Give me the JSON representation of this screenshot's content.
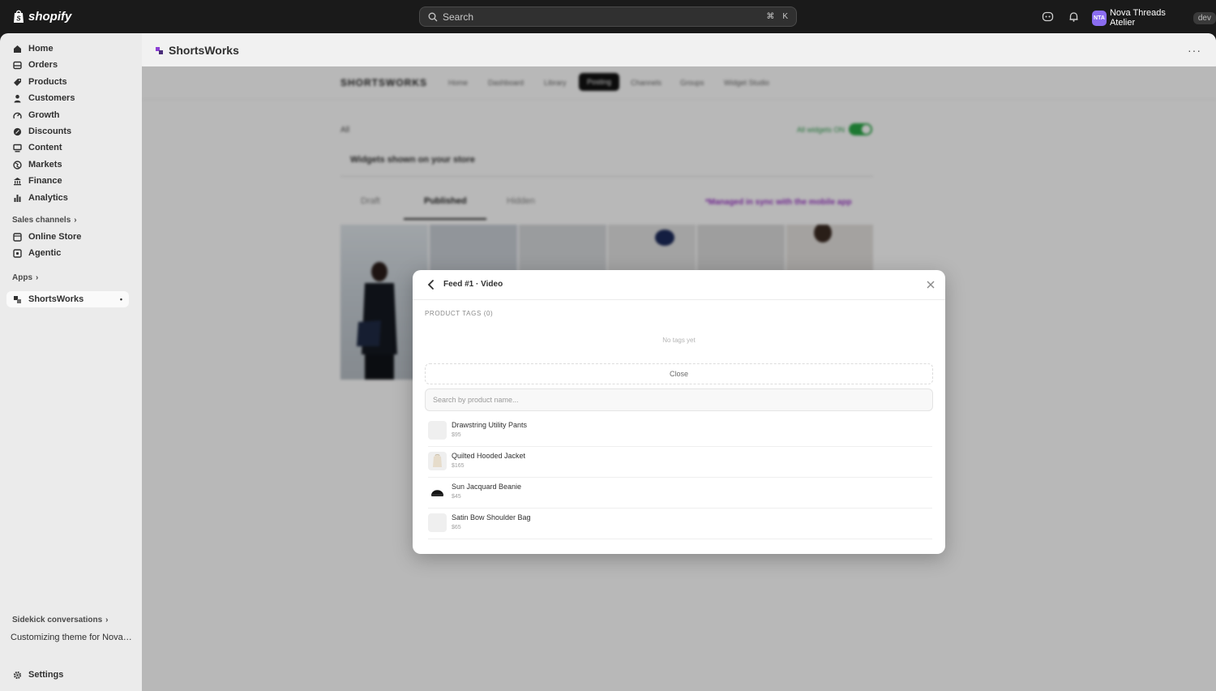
{
  "topbar": {
    "brand": "shopify",
    "search_placeholder": "Search",
    "shortcut_cmd": "⌘",
    "shortcut_key": "K",
    "avatar_initials": "NTA",
    "store_name": "Nova Threads Atelier",
    "env_badge": "dev"
  },
  "sidebar": {
    "items": [
      {
        "label": "Home",
        "icon": "home-icon"
      },
      {
        "label": "Orders",
        "icon": "orders-icon"
      },
      {
        "label": "Products",
        "icon": "tag-icon"
      },
      {
        "label": "Customers",
        "icon": "person-icon"
      },
      {
        "label": "Growth",
        "icon": "growth-icon"
      },
      {
        "label": "Discounts",
        "icon": "discount-icon"
      },
      {
        "label": "Content",
        "icon": "content-icon"
      },
      {
        "label": "Markets",
        "icon": "globe-icon"
      },
      {
        "label": "Finance",
        "icon": "bank-icon"
      },
      {
        "label": "Analytics",
        "icon": "bar-chart-icon"
      }
    ],
    "sales_channels_label": "Sales channels",
    "channels": [
      {
        "label": "Online Store",
        "icon": "store-icon"
      },
      {
        "label": "Agentic",
        "icon": "agentic-icon"
      }
    ],
    "apps_label": "Apps",
    "apps": [
      {
        "label": "ShortsWorks",
        "icon": "shortsworks-icon",
        "active": true
      }
    ],
    "sidekick_label": "Sidekick conversations",
    "sidekick_item": "Customizing theme for Nova Threads Atelier",
    "settings_label": "Settings"
  },
  "app": {
    "title": "ShortsWorks",
    "more_label": "···",
    "brand_logo": "SHORTSWORKS",
    "tabs": [
      "Home",
      "Dashboard",
      "Library",
      "Posting",
      "Channels",
      "Groups",
      "Widget Studio"
    ],
    "active_tab": "Posting",
    "filter_label": "All",
    "switch_label": "All widgets ON",
    "widgets_title": "Widgets shown on your store",
    "subtabs": [
      "Draft",
      "Published",
      "Hidden"
    ],
    "active_subtab": "Published",
    "sync_note": "*Managed in sync with the mobile app"
  },
  "modal": {
    "title": "Feed #1 · Video",
    "tags_label": "PRODUCT TAGS (0)",
    "empty_text": "No tags yet",
    "close_label": "Close",
    "search_placeholder": "Search by product name...",
    "products": [
      {
        "name": "Drawstring Utility Pants",
        "price": "$95"
      },
      {
        "name": "Quilted Hooded Jacket",
        "price": "$165"
      },
      {
        "name": "Sun Jacquard Beanie",
        "price": "$45"
      },
      {
        "name": "Satin Bow Shoulder Bag",
        "price": "$65"
      }
    ]
  },
  "colors": {
    "topbar_bg": "#1a1a1a",
    "sidebar_bg": "#ebebeb",
    "accent_purple": "#9a35c6",
    "switch_green": "#29a745",
    "avatar_purple": "#8a6cf0"
  }
}
